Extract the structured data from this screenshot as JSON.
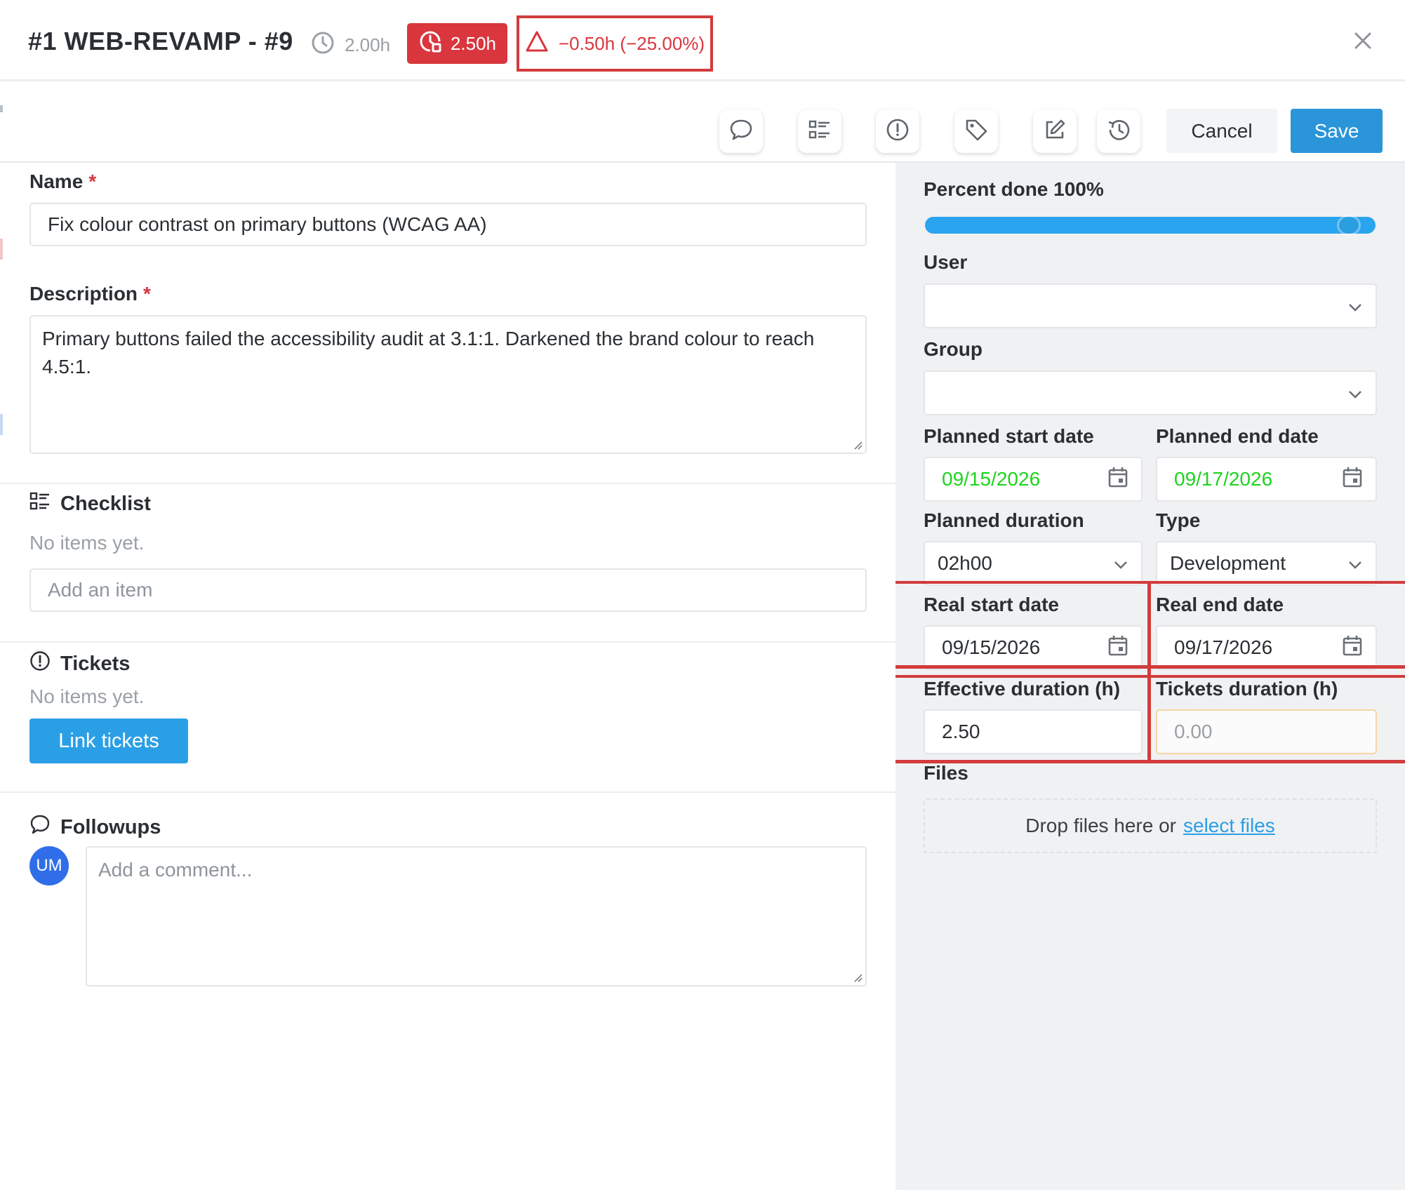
{
  "header": {
    "title": "#1 WEB-REVAMP - #9",
    "planned_time": "2.00h",
    "real_time": "2.50h",
    "delta": "−0.50h (−25.00%)",
    "colors": {
      "danger": "#d9363e",
      "accent": "#2a95d9"
    }
  },
  "toolbar": {
    "cancel_label": "Cancel",
    "save_label": "Save",
    "icons": [
      "comment-icon",
      "checklist-icon",
      "ticket-alert-icon",
      "tag-icon",
      "edit-icon",
      "history-icon"
    ]
  },
  "form": {
    "name_label": "Name",
    "name_value": "Fix colour contrast on primary buttons (WCAG AA)",
    "description_label": "Description",
    "description_value": "Primary buttons failed the accessibility audit at 3.1:1. Darkened the brand colour to reach 4.5:1.",
    "required_mark": "*"
  },
  "checklist": {
    "title": "Checklist",
    "empty_text": "No items yet.",
    "add_placeholder": "Add an item"
  },
  "tickets": {
    "title": "Tickets",
    "empty_text": "No items yet.",
    "link_label": "Link tickets"
  },
  "followups": {
    "title": "Followups",
    "avatar_initials": "UM",
    "comment_placeholder": "Add a comment..."
  },
  "sidebar": {
    "percent_label": "Percent done 100%",
    "percent_value": 1.0,
    "user_label": "User",
    "user_value": "",
    "group_label": "Group",
    "group_value": "",
    "planned_start_label": "Planned start date",
    "planned_start_value": "09/15/2026",
    "planned_end_label": "Planned end date",
    "planned_end_value": "09/17/2026",
    "planned_duration_label": "Planned duration",
    "planned_duration_value": "02h00",
    "type_label": "Type",
    "type_value": "Development",
    "real_start_label": "Real start date",
    "real_start_value": "09/15/2026",
    "real_end_label": "Real end date",
    "real_end_value": "09/17/2026",
    "effective_duration_label": "Effective duration (h)",
    "effective_duration_value": "2.50",
    "tickets_duration_label": "Tickets duration (h)",
    "tickets_duration_value": "0.00",
    "files_label": "Files",
    "drop_text": "Drop files here or",
    "select_files_label": "select files"
  }
}
